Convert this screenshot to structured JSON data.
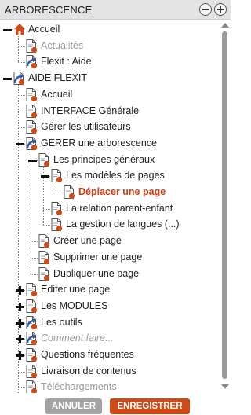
{
  "panel": {
    "title": "ARBORESCENCE"
  },
  "tree": [
    {
      "id": "accueil",
      "label": "Accueil",
      "level": 0,
      "icon": "home-icon",
      "toggle": "minus",
      "style": ""
    },
    {
      "id": "actualites",
      "label": "Actualités",
      "level": 1,
      "icon": "page-icon",
      "toggle": "",
      "style": "muted"
    },
    {
      "id": "flexit-aide",
      "label": "Flexit : Aide",
      "level": 1,
      "icon": "link-page-icon",
      "toggle": "",
      "style": ""
    },
    {
      "id": "aide-flexit",
      "label": "AIDE FLEXIT",
      "level": 0,
      "icon": "link-page-icon",
      "toggle": "minus",
      "style": ""
    },
    {
      "id": "accueil-2",
      "label": "Accueil",
      "level": 1,
      "icon": "page-icon",
      "toggle": "",
      "style": ""
    },
    {
      "id": "interface",
      "label": "INTERFACE Générale",
      "level": 1,
      "icon": "page-icon",
      "toggle": "",
      "style": ""
    },
    {
      "id": "gerer-utilisateurs",
      "label": "Gérer les utilisateurs",
      "level": 1,
      "icon": "page-icon",
      "toggle": "",
      "style": ""
    },
    {
      "id": "gerer-arborescence",
      "label": "GERER une arborescence",
      "level": 1,
      "icon": "link-page-icon",
      "toggle": "minus",
      "style": ""
    },
    {
      "id": "principes",
      "label": "Les principes généraux",
      "level": 2,
      "icon": "page-icon",
      "toggle": "minus",
      "style": ""
    },
    {
      "id": "modeles",
      "label": "Les modèles de pages",
      "level": 3,
      "icon": "page-icon",
      "toggle": "minus",
      "style": ""
    },
    {
      "id": "deplacer",
      "label": "Déplacer une page",
      "level": 4,
      "icon": "page-icon",
      "toggle": "",
      "style": "active"
    },
    {
      "id": "relation",
      "label": "La relation parent-enfant",
      "level": 3,
      "icon": "page-icon",
      "toggle": "",
      "style": ""
    },
    {
      "id": "langues",
      "label": "La gestion de langues (...)",
      "level": 3,
      "icon": "page-icon",
      "toggle": "",
      "style": ""
    },
    {
      "id": "creer",
      "label": "Créer une page",
      "level": 2,
      "icon": "page-icon",
      "toggle": "",
      "style": ""
    },
    {
      "id": "supprimer",
      "label": "Supprimer une page",
      "level": 2,
      "icon": "page-icon",
      "toggle": "",
      "style": ""
    },
    {
      "id": "dupliquer",
      "label": "Dupliquer une page",
      "level": 2,
      "icon": "page-icon",
      "toggle": "",
      "style": ""
    },
    {
      "id": "editer",
      "label": "Editer une page",
      "level": 1,
      "icon": "page-icon",
      "toggle": "plus",
      "style": ""
    },
    {
      "id": "modules",
      "label": "Les MODULES",
      "level": 1,
      "icon": "page-icon",
      "toggle": "plus",
      "style": ""
    },
    {
      "id": "outils",
      "label": "Les outils",
      "level": 1,
      "icon": "link-page-icon",
      "toggle": "plus",
      "style": ""
    },
    {
      "id": "comment-faire",
      "label": "Comment faire...",
      "level": 1,
      "icon": "link-page-icon",
      "toggle": "plus",
      "style": "muted ital"
    },
    {
      "id": "questions",
      "label": "Questions fréquentes",
      "level": 1,
      "icon": "page-icon",
      "toggle": "plus",
      "style": ""
    },
    {
      "id": "livraison",
      "label": "Livraison de contenus",
      "level": 1,
      "icon": "page-icon",
      "toggle": "",
      "style": ""
    },
    {
      "id": "telechargements",
      "label": "Téléchargements",
      "level": 1,
      "icon": "page-icon",
      "toggle": "",
      "style": "muted"
    },
    {
      "id": "cut-off",
      "label": "",
      "level": 1,
      "icon": "page-icon",
      "toggle": "",
      "style": ""
    }
  ],
  "footer": {
    "cancel_label": "ANNULER",
    "save_label": "ENREGISTRER"
  },
  "colors": {
    "accent": "#cf4a17",
    "active_text": "#d03b10",
    "muted_text": "#9a9a9a",
    "header_bg": "#e3e3e3",
    "page_icon_stroke": "#555555",
    "link_icon_blue": "#2f5aa8"
  }
}
